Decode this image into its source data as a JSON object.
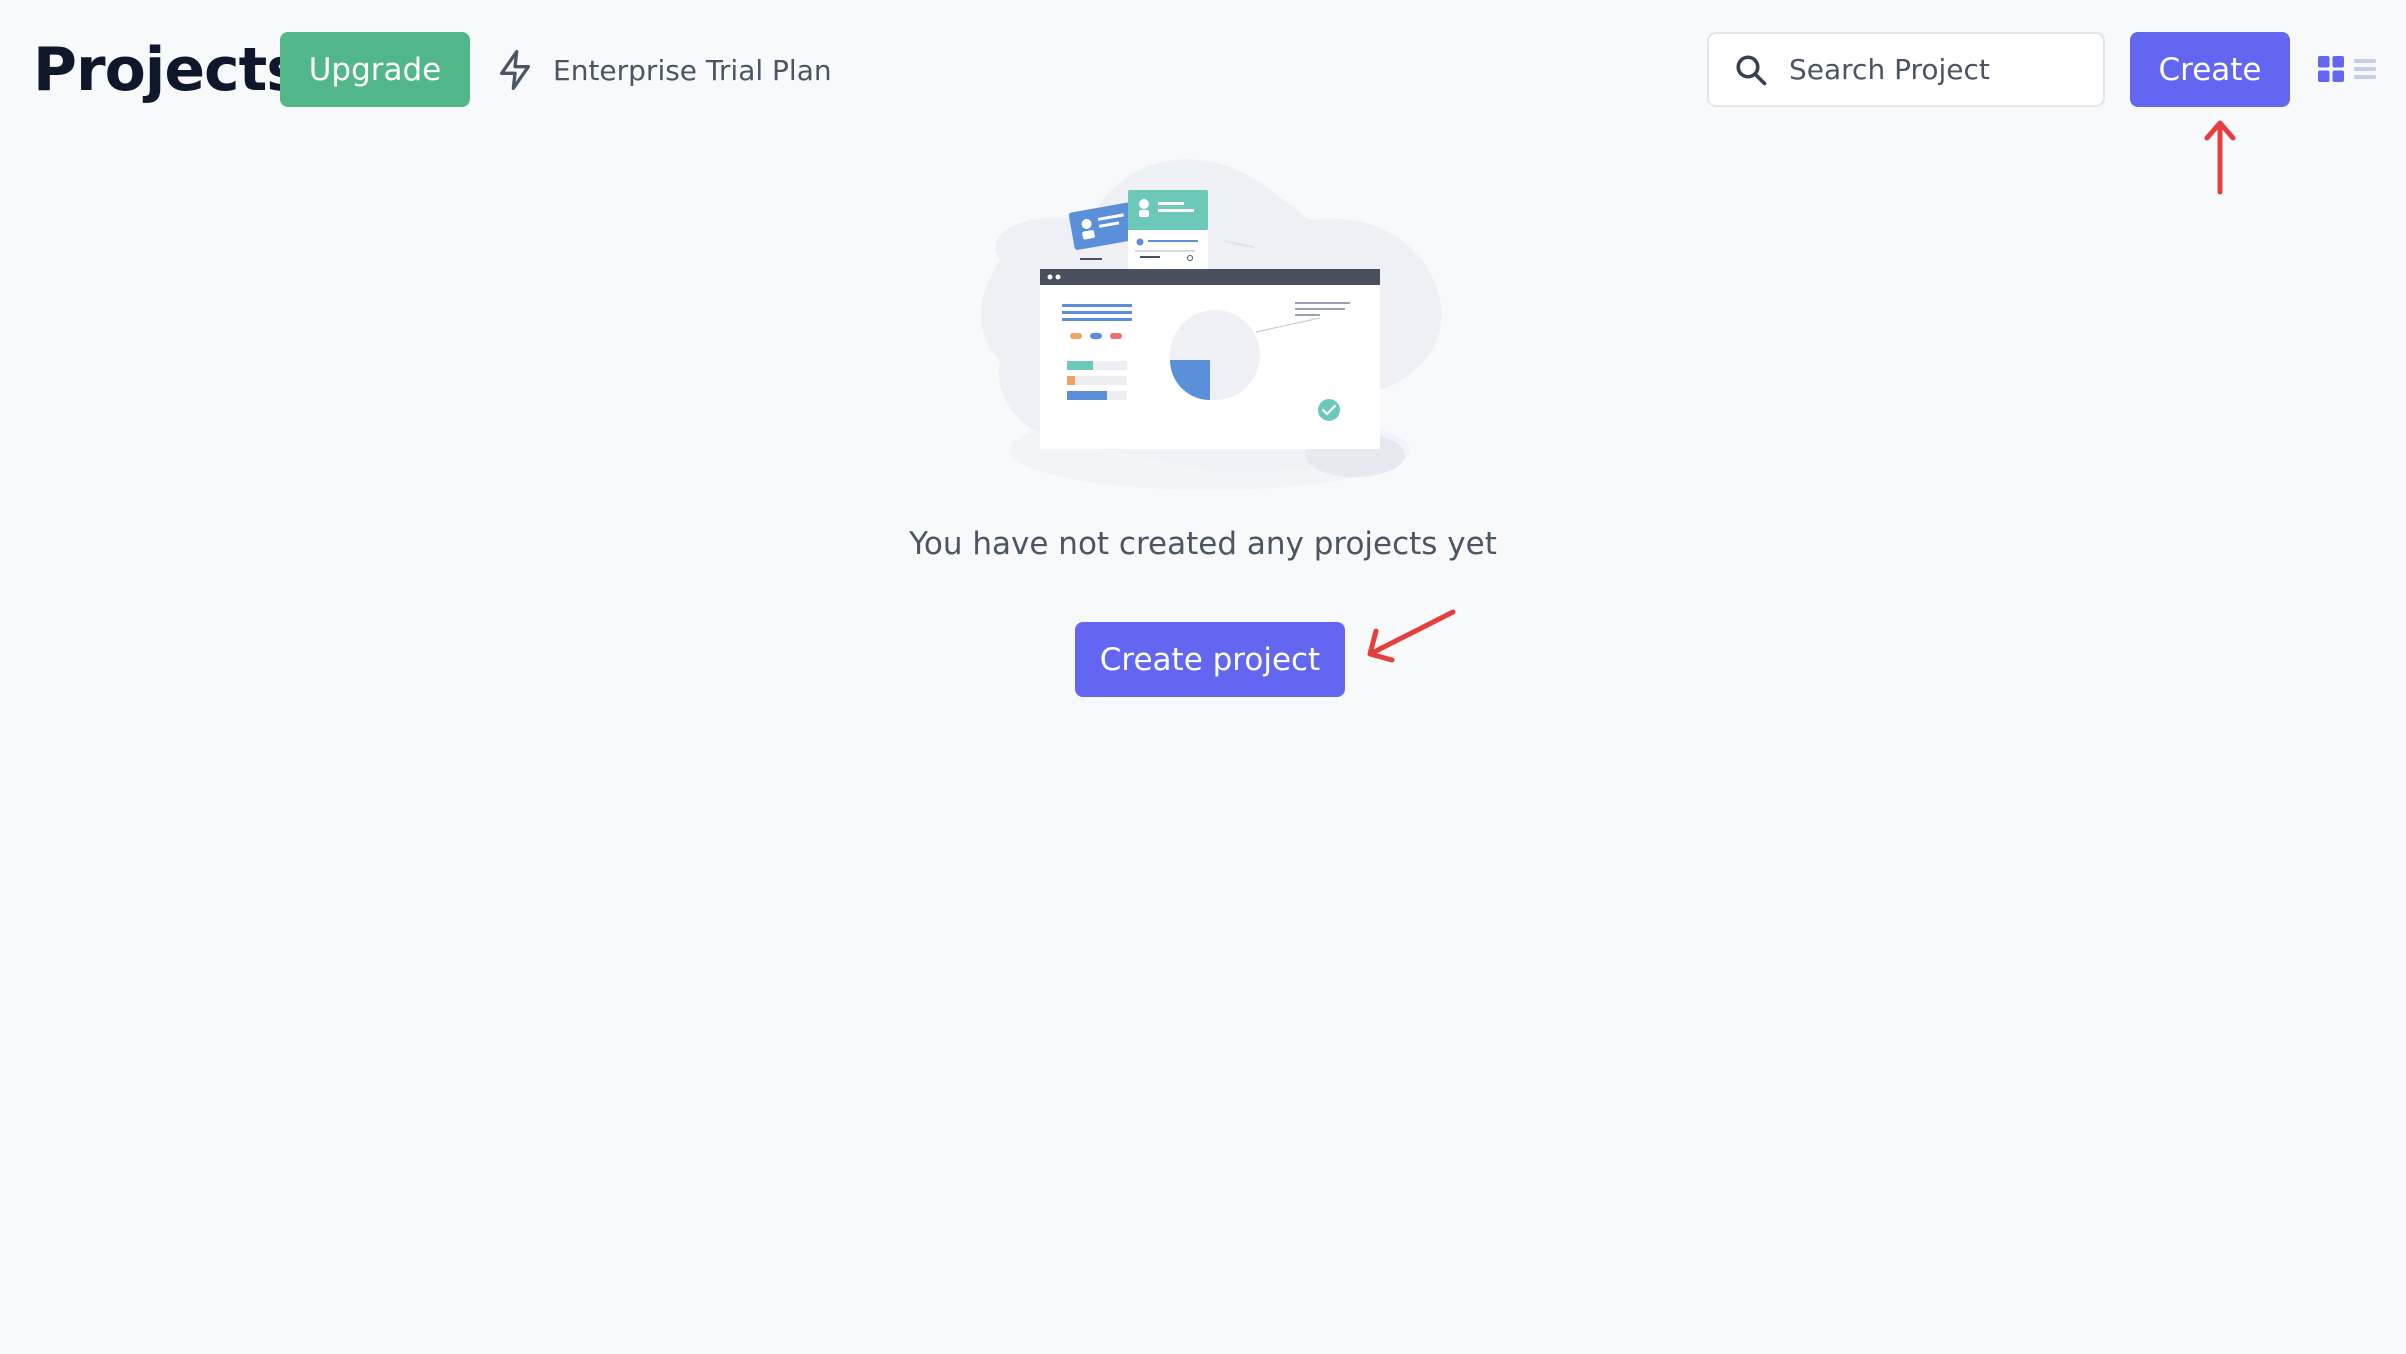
{
  "header": {
    "title": "Projects",
    "upgrade_label": "Upgrade",
    "plan_label": "Enterprise Trial Plan",
    "plan_icon": "lightning-icon"
  },
  "search": {
    "placeholder": "Search Project",
    "value": "",
    "icon": "search-icon"
  },
  "toolbar": {
    "create_label": "Create",
    "view_modes": [
      "grid-view-icon",
      "list-view-icon"
    ],
    "active_view": "grid"
  },
  "empty_state": {
    "message": "You have not created any projects yet",
    "button_label": "Create project"
  },
  "colors": {
    "background": "#f8f9fb",
    "upgrade": "#52b788",
    "primary": "#6366f1",
    "annotation": "#e53e3e",
    "text_muted": "#4b5563"
  }
}
